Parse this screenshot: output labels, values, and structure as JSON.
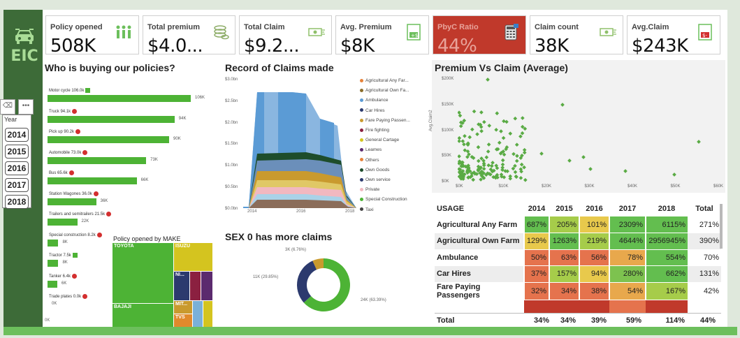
{
  "app": {
    "logo_text": "EIC"
  },
  "kpis": [
    {
      "label": "Policy opened",
      "value": "508K",
      "icon": "people-icon"
    },
    {
      "label": "Total premium",
      "value": "$4.0...",
      "icon": "coins-icon"
    },
    {
      "label": "Total Claim",
      "value": "$9.2...",
      "icon": "cash-icon"
    },
    {
      "label": "Avg. Premium",
      "value": "$8K",
      "icon": "money-doc-icon"
    },
    {
      "label": "PbyC Ratio",
      "value": "44%",
      "icon": "calculator-icon"
    },
    {
      "label": "Claim count",
      "value": "38K",
      "icon": "cash-icon"
    },
    {
      "label": "Avg.Claim",
      "value": "$243K",
      "icon": "money-doc-red-icon"
    }
  ],
  "slicer": {
    "title": "Year",
    "years": [
      "2014",
      "2015",
      "2016",
      "2017",
      "2018"
    ]
  },
  "buyers": {
    "title": "Who is buying our policies?",
    "rows": [
      {
        "label": "Motor cycle 106.0k",
        "value": 106,
        "value_label": "106K",
        "marker": "check"
      },
      {
        "label": "Truck 94.1k",
        "value": 94,
        "value_label": "94K",
        "marker": "dot"
      },
      {
        "label": "Pick up 90.2k",
        "value": 90,
        "value_label": "90K",
        "marker": "dot"
      },
      {
        "label": "Automobile 73.0k",
        "value": 73,
        "value_label": "73K",
        "marker": "dot"
      },
      {
        "label": "Bus 65.6k",
        "value": 66,
        "value_label": "66K",
        "marker": "dot"
      },
      {
        "label": "Station Wagones 36.0k",
        "value": 36,
        "value_label": "36K",
        "marker": "dot"
      },
      {
        "label": "Trailers and semitrailers 21.5k",
        "value": 22,
        "value_label": "22K",
        "marker": "dot"
      },
      {
        "label": "Special construction 8.2k",
        "value": 8,
        "value_label": "8K",
        "marker": "dot"
      },
      {
        "label": "Tractor 7.5k",
        "value": 8,
        "value_label": "8K",
        "marker": "check"
      },
      {
        "label": "Tanker 6.4k",
        "value": 6,
        "value_label": "6K",
        "marker": "dot"
      },
      {
        "label": "Trade plates 0.0k",
        "value": 0,
        "value_label": "0K",
        "marker": "dot"
      }
    ],
    "axis_zero": "0K"
  },
  "make": {
    "title": "Policy opened by MAKE",
    "tiles": [
      {
        "label": "TOYOTA",
        "color": "#4db335"
      },
      {
        "label": "BAJAJI",
        "color": "#4db335"
      },
      {
        "label": "ISUZU",
        "color": "#d4c41f"
      },
      {
        "label": "NI...",
        "color": "#2c3a6e"
      },
      {
        "label": "MIT...",
        "color": "#c99a2e"
      },
      {
        "label": "TVS",
        "color": "#e08a2c"
      },
      {
        "label": "",
        "color": "#8b2040"
      },
      {
        "label": "",
        "color": "#5b2a6e"
      },
      {
        "label": "",
        "color": "#7ab0d8"
      }
    ]
  },
  "claims_chart": {
    "title": "Record of Claims made",
    "y_ticks": [
      "$3.0bn",
      "$2.5bn",
      "$2.0bn",
      "$1.5bn",
      "$1.0bn",
      "$0.5bn",
      "$0.0bn"
    ],
    "x_ticks": [
      "2014",
      "2016",
      "2018"
    ],
    "legend": [
      {
        "label": "Agricultural Any Far...",
        "color": "#e6823a"
      },
      {
        "label": "Agricultural Own Fa...",
        "color": "#8a6d2a"
      },
      {
        "label": "Ambulance",
        "color": "#5b9bd5"
      },
      {
        "label": "Car Hires",
        "color": "#2c3a6e"
      },
      {
        "label": "Fare Paying Passen...",
        "color": "#c99a2e"
      },
      {
        "label": "Fire fighting",
        "color": "#8b2040"
      },
      {
        "label": "General Cartage",
        "color": "#d4c41f"
      },
      {
        "label": "Leames",
        "color": "#5b2a6e"
      },
      {
        "label": "Others",
        "color": "#e6823a"
      },
      {
        "label": "Own Goods",
        "color": "#1e4d2b"
      },
      {
        "label": "Own service",
        "color": "#2c3a6e"
      },
      {
        "label": "Private",
        "color": "#f2b8c0"
      },
      {
        "label": "Special Construction",
        "color": "#4db335"
      },
      {
        "label": "Taxi",
        "color": "#444444"
      }
    ]
  },
  "sex_chart": {
    "title": "SEX 0 has more claims",
    "slices": [
      {
        "label": "24K (63.39%)",
        "value": 63.39,
        "color": "#4db335"
      },
      {
        "label": "11K (29.85%)",
        "value": 29.85,
        "color": "#2c3a6e"
      },
      {
        "label": "3K (6.76%)",
        "value": 6.76,
        "color": "#c99a2e"
      }
    ]
  },
  "scatter": {
    "title": "Premium Vs Claim (Average)",
    "ylabel": "Avg.Claim2",
    "y_ticks": [
      "$200K",
      "$150K",
      "$100K",
      "$50K",
      "$0K"
    ],
    "x_ticks": [
      "$0K",
      "$10K",
      "$20K",
      "$30K",
      "$40K",
      "$50K",
      "$60K"
    ]
  },
  "usage": {
    "headers": [
      "USAGE",
      "2014",
      "2015",
      "2016",
      "2017",
      "2018",
      "Total"
    ],
    "rows": [
      {
        "name": "Agricultural Any Farm",
        "cells": [
          "687%",
          "205%",
          "101%",
          "2309%",
          "6115%"
        ],
        "colors": [
          "#63be4f",
          "#a6cc4a",
          "#e8c94c",
          "#63be4f",
          "#63be4f"
        ],
        "total": "271%"
      },
      {
        "name": "Agricultural Own Farm",
        "cells": [
          "129%",
          "1263%",
          "219%",
          "4644%",
          "2956945%"
        ],
        "colors": [
          "#e8c94c",
          "#63be4f",
          "#a6cc4a",
          "#63be4f",
          "#63be4f"
        ],
        "total": "390%"
      },
      {
        "name": "Ambulance",
        "cells": [
          "50%",
          "63%",
          "56%",
          "78%",
          "554%"
        ],
        "colors": [
          "#e5734d",
          "#e5734d",
          "#e5734d",
          "#e8a84c",
          "#63be4f"
        ],
        "total": "70%"
      },
      {
        "name": "Car Hires",
        "cells": [
          "37%",
          "157%",
          "94%",
          "280%",
          "662%"
        ],
        "colors": [
          "#e5734d",
          "#a6cc4a",
          "#e8c94c",
          "#7dc24f",
          "#63be4f"
        ],
        "total": "131%"
      },
      {
        "name": "Fare Paying Passengers",
        "cells": [
          "32%",
          "34%",
          "38%",
          "54%",
          "167%"
        ],
        "colors": [
          "#e5734d",
          "#e5734d",
          "#e5734d",
          "#e8a84c",
          "#a6cc4a"
        ],
        "total": "42%"
      }
    ],
    "total_row": {
      "name": "Total",
      "cells": [
        "34%",
        "34%",
        "39%",
        "59%",
        "114%"
      ],
      "total": "44%"
    }
  }
}
